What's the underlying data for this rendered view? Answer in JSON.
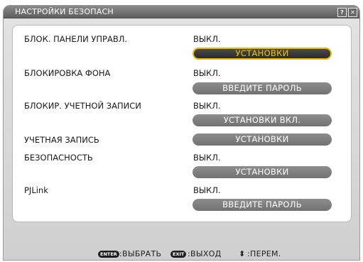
{
  "title": "НАСТРОЙКИ БЕЗОПАСН",
  "titlebar": {
    "help_glyph": "?",
    "close_glyph": "✕"
  },
  "rows": [
    {
      "label": "БЛОК. ПАНЕЛИ УПРАВЛ.",
      "value": "ВЫКЛ.",
      "button": "УСТАНОВКИ",
      "selected": true
    },
    {
      "label": "БЛОКИРОВКА ФОНА",
      "value": "ВЫКЛ.",
      "button": "ВВЕДИТЕ ПАРОЛЬ",
      "selected": false
    },
    {
      "label": "БЛОКИР. УЧЕТНОЙ ЗАПИСИ",
      "value": "ВЫКЛ.",
      "button": "УСТАНОВКИ ВКЛ.",
      "selected": false
    },
    {
      "label": "УЧЕТНАЯ ЗАПИСЬ",
      "value": "",
      "button": "УСТАНОВКИ",
      "selected": false
    },
    {
      "label": "БЕЗОПАСНОСТЬ",
      "value": "ВЫКЛ.",
      "button": "УСТАНОВКИ",
      "selected": false
    },
    {
      "label": "PJLink",
      "value": "ВЫКЛ.",
      "button": "ВВЕДИТЕ ПАРОЛЬ",
      "selected": false
    }
  ],
  "footer": {
    "enter_key": "ENTER",
    "enter_text": ":ВЫБРАТЬ",
    "exit_key": "EXIT",
    "exit_text": ":ВЫХОД",
    "move_glyph": "⬍",
    "move_text": ":ПЕРЕМ."
  },
  "colors": {
    "accent": "#e6b800",
    "button": "#7f7f7f",
    "titlebar": "#6e6e6e"
  }
}
